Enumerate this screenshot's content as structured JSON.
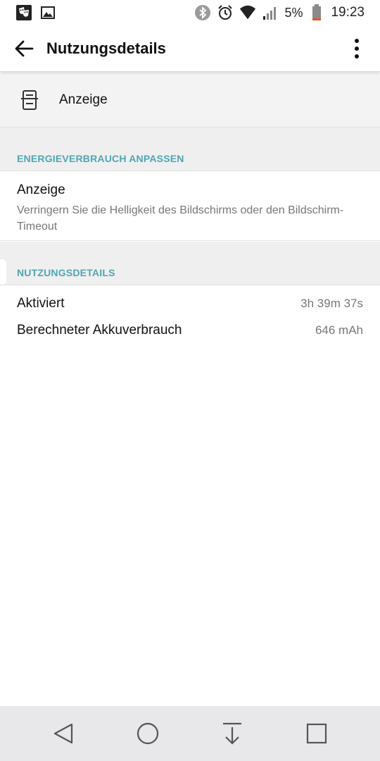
{
  "status_bar": {
    "battery_percent": "5%",
    "time": "19:23"
  },
  "app_bar": {
    "title": "Nutzungsdetails"
  },
  "app_header": {
    "label": "Anzeige"
  },
  "section_energy": {
    "header": "ENERGIEVERBRAUCH ANPASSEN",
    "item_title": "Anzeige",
    "item_summary": "Verringern Sie die Helligkeit des Bildschirms oder den Bildschirm-Timeout"
  },
  "section_usage": {
    "header": "NUTZUNGSDETAILS",
    "rows": [
      {
        "label": "Aktiviert",
        "value": "3h 39m 37s"
      },
      {
        "label": "Berechneter Akkuverbrauch",
        "value": "646 mAh"
      }
    ]
  },
  "colors": {
    "section_header_text": "#4fa5b3",
    "battery_low": "#e0532b"
  }
}
